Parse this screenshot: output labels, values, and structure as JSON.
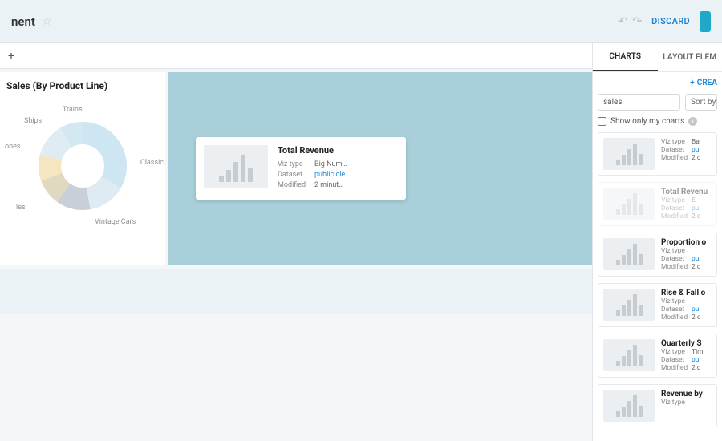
{
  "header": {
    "title": "nent",
    "discard_label": "DISCARD"
  },
  "canvas": {
    "panel_title": "Sales (By Product Line)",
    "donut_labels": [
      "Trains",
      "Ships",
      "ones",
      "Classic",
      "Vintage Cars",
      "les"
    ]
  },
  "drag_card": {
    "title": "Total Revenue",
    "viz_label": "Viz type",
    "viz_value": "Big Num…",
    "dataset_label": "Dataset",
    "dataset_value": "public.cle…",
    "modified_label": "Modified",
    "modified_value": "2 minut…"
  },
  "sidebar": {
    "tab_charts": "CHARTS",
    "tab_layout": "LAYOUT ELEM",
    "create_label": "CREA",
    "search_value": "sales",
    "sort_label": "Sort by r",
    "show_mine": "Show only my charts",
    "items": [
      {
        "title": "",
        "viz": "Ba",
        "dataset": "pu",
        "modified": "2 c",
        "faded": false,
        "no_title": true
      },
      {
        "title": "Total Revenu",
        "viz": "E",
        "dataset": "pu",
        "modified": "2 c",
        "faded": true
      },
      {
        "title": "Proportion o",
        "viz": "",
        "dataset": "pu",
        "modified": "2 c",
        "faded": false
      },
      {
        "title": "Rise & Fall o",
        "viz": "",
        "dataset": "pu",
        "modified": "2 c",
        "faded": false
      },
      {
        "title": "Quarterly S",
        "viz": "Tim",
        "dataset": "pu",
        "modified": "2 c",
        "faded": false
      },
      {
        "title": "Revenue by",
        "viz": "",
        "dataset": "",
        "modified": "",
        "faded": false
      }
    ],
    "meta_labels": {
      "viz": "Viz type",
      "dataset": "Dataset",
      "modified": "Modified"
    }
  }
}
